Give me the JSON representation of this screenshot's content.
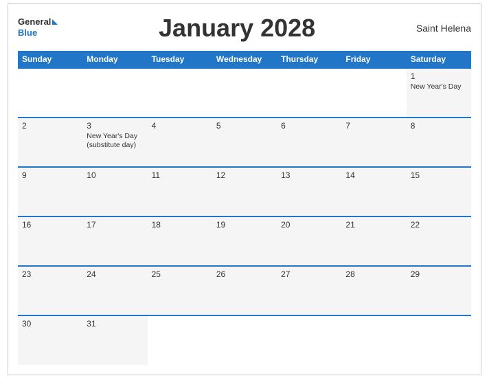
{
  "header": {
    "logo_general": "General",
    "logo_blue": "Blue",
    "title": "January 2028",
    "region": "Saint Helena"
  },
  "weekdays": [
    "Sunday",
    "Monday",
    "Tuesday",
    "Wednesday",
    "Thursday",
    "Friday",
    "Saturday"
  ],
  "weeks": [
    [
      {
        "day": "",
        "empty": true
      },
      {
        "day": "",
        "empty": true
      },
      {
        "day": "",
        "empty": true
      },
      {
        "day": "",
        "empty": true
      },
      {
        "day": "",
        "empty": true
      },
      {
        "day": "",
        "empty": true
      },
      {
        "day": "1",
        "events": [
          "New Year's Day"
        ]
      }
    ],
    [
      {
        "day": "2",
        "events": []
      },
      {
        "day": "3",
        "events": [
          "New Year's Day",
          "(substitute day)"
        ]
      },
      {
        "day": "4",
        "events": []
      },
      {
        "day": "5",
        "events": []
      },
      {
        "day": "6",
        "events": []
      },
      {
        "day": "7",
        "events": []
      },
      {
        "day": "8",
        "events": []
      }
    ],
    [
      {
        "day": "9",
        "events": []
      },
      {
        "day": "10",
        "events": []
      },
      {
        "day": "11",
        "events": []
      },
      {
        "day": "12",
        "events": []
      },
      {
        "day": "13",
        "events": []
      },
      {
        "day": "14",
        "events": []
      },
      {
        "day": "15",
        "events": []
      }
    ],
    [
      {
        "day": "16",
        "events": []
      },
      {
        "day": "17",
        "events": []
      },
      {
        "day": "18",
        "events": []
      },
      {
        "day": "19",
        "events": []
      },
      {
        "day": "20",
        "events": []
      },
      {
        "day": "21",
        "events": []
      },
      {
        "day": "22",
        "events": []
      }
    ],
    [
      {
        "day": "23",
        "events": []
      },
      {
        "day": "24",
        "events": []
      },
      {
        "day": "25",
        "events": []
      },
      {
        "day": "26",
        "events": []
      },
      {
        "day": "27",
        "events": []
      },
      {
        "day": "28",
        "events": []
      },
      {
        "day": "29",
        "events": []
      }
    ],
    [
      {
        "day": "30",
        "events": []
      },
      {
        "day": "31",
        "events": []
      },
      {
        "day": "",
        "empty": true
      },
      {
        "day": "",
        "empty": true
      },
      {
        "day": "",
        "empty": true
      },
      {
        "day": "",
        "empty": true
      },
      {
        "day": "",
        "empty": true
      }
    ]
  ],
  "colors": {
    "header_bg": "#2176c7",
    "row_bg": "#f5f5f5",
    "empty_bg": "#ffffff"
  }
}
